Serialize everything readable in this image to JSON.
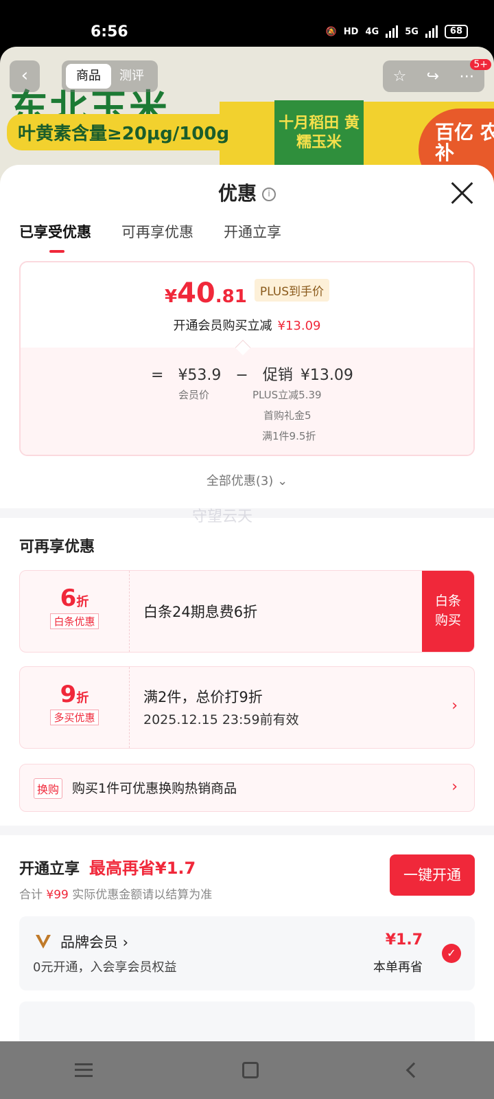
{
  "status_bar": {
    "time": "6:56",
    "network1": "4G",
    "network2": "5G",
    "hd": "HD",
    "battery": "68"
  },
  "background": {
    "big_text": "东北玉米",
    "pill_text": "叶黄素含量≥20μg/100g",
    "box_text": "十月稻田 黄糯玉米",
    "badge_text": "百亿 农补",
    "tab_product": "商品",
    "tab_review": "测评",
    "count_badge": "5+"
  },
  "sheet": {
    "title": "优惠",
    "info_icon_glyph": "i",
    "tabs": [
      "已享受优惠",
      "可再享优惠",
      "开通立享"
    ],
    "price": {
      "yen": "¥",
      "int": "40",
      "dec": ".81",
      "plus_tag": "PLUS到手价",
      "sub_text": "开通会员购买立减",
      "sub_amount": "¥13.09"
    },
    "formula": {
      "eq": "=",
      "member_price": "¥53.9",
      "minus": "−",
      "promo_label": "促销",
      "promo_amount": "¥13.09",
      "member_price_label": "会员价",
      "details": [
        "PLUS立减5.39",
        "首购礼金5",
        "满1件9.5折"
      ]
    },
    "all_promos": "全部优惠(3)",
    "all_promos_chevron": "⌄",
    "watermark": "守望云天",
    "more_section_title": "可再享优惠",
    "cards": [
      {
        "discount_num": "6",
        "discount_unit": "折",
        "tag": "白条优惠",
        "text": "白条24期息费6折",
        "side_button": [
          "白条",
          "购买"
        ]
      },
      {
        "discount_num": "9",
        "discount_unit": "折",
        "tag": "多买优惠",
        "text": "满2件，总价打9折",
        "subtext": "2025.12.15 23:59前有效",
        "chevron": "›"
      }
    ],
    "swap": {
      "tag": "换购",
      "text": "购买1件可优惠换购热销商品",
      "chevron": "›"
    },
    "open_section": {
      "title": "开通立享",
      "highlight": "最高再省¥1.7",
      "total_prefix": "合计",
      "total_amount": "¥99",
      "total_suffix": "实际优惠金额请以结算为准",
      "button": "一键开通"
    },
    "member": {
      "name": "品牌会员 ›",
      "desc": "0元开通，入会享会员权益",
      "amount": "¥1.7",
      "save_label": "本单再省",
      "check_glyph": "✓"
    }
  },
  "colors": {
    "accent": "#f0283a",
    "plus_bg": "#fdf0d8",
    "card_bg": "#fff6f7"
  }
}
